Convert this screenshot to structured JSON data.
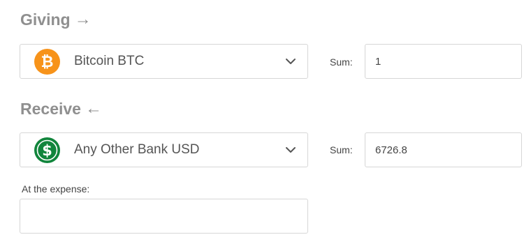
{
  "giving": {
    "title": "Giving",
    "arrow": "→",
    "currency": {
      "label": "Bitcoin BTC",
      "icon": "bitcoin-icon",
      "icon_glyph": "₿",
      "icon_color": "#f7931a"
    },
    "sum_label": "Sum:",
    "sum_value": "1"
  },
  "receive": {
    "title": "Receive",
    "arrow": "←",
    "currency": {
      "label": "Any Other Bank USD",
      "icon": "dollar-icon",
      "icon_glyph": "$",
      "icon_color": "#11853c"
    },
    "sum_label": "Sum:",
    "sum_value": "6726.8"
  },
  "expense": {
    "label": "At the expense:",
    "value": ""
  }
}
